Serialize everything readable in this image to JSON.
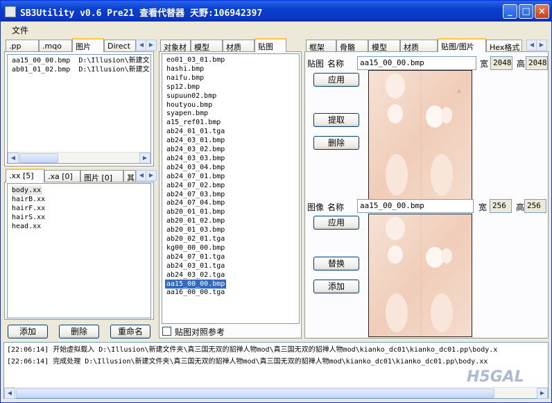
{
  "window": {
    "title": "SB3Utility v0.6 Pre21 查看代替器 天野:106942397",
    "minimize": "_",
    "maximize": "□",
    "close": "×"
  },
  "menu": {
    "file": "文件"
  },
  "left_top": {
    "tabs": [
      ".pp",
      ".mqo",
      "图片",
      "Direct"
    ],
    "items": [
      {
        "name": "aa15_00_00.bmp",
        "path": "D:\\Illusion\\新建文"
      },
      {
        "name": "ab01_01_02.bmp",
        "path": "D:\\Illusion\\新建文"
      }
    ]
  },
  "left_bottom": {
    "tabs": [
      ".xx [5]",
      ".xa [0]",
      "图片 [0]",
      "其"
    ],
    "items": [
      "body.xx",
      "hairB.xx",
      "hairF.xx",
      "hairS.xx",
      "head.xx"
    ],
    "buttons": {
      "add": "添加",
      "delete": "删除",
      "rename": "重命名"
    }
  },
  "middle": {
    "tabs": [
      "对象材",
      "模型",
      "材质",
      "贴图"
    ],
    "items": [
      "eo01_03_01.bmp",
      "hashi.bmp",
      "naifu.bmp",
      "sp12.bmp",
      "supuun02.bmp",
      "houtyou.bmp",
      "syapen.bmp",
      "a15_ref01.bmp",
      "ab24_01_01.tga",
      "ab24_03_01.bmp",
      "ab24_03_02.bmp",
      "ab24_03_03.bmp",
      "ab24_03_04.bmp",
      "ab24_07_01.bmp",
      "ab24_07_02.bmp",
      "ab24_07_03.bmp",
      "ab24_07_04.bmp",
      "ab20_01_01.bmp",
      "ab20_01_02.bmp",
      "ab20_01_03.bmp",
      "ab20_02_01.tga",
      "kg00_00_00.bmp",
      "ab24_07_01.tga",
      "ab24_03_01.tga",
      "ab24_03_02.tga",
      "aa15_00_00.bmp",
      "aa16_00_00.tga"
    ],
    "selected_index": 25,
    "checkbox_label": "贴图对照参考"
  },
  "right": {
    "tabs": [
      "框架",
      "骨骼",
      "模型",
      "材质",
      "贴图/图片",
      "Hex格式"
    ],
    "texture": {
      "label_left": "贴图",
      "label_name": "名称",
      "name": "aa15_00_00.bmp",
      "width_label": "宽",
      "width": "2048",
      "height_label": "高",
      "height": "2048",
      "apply": "应用",
      "extract": "提取",
      "delete": "删除"
    },
    "image": {
      "label_left": "图像",
      "label_name": "名称",
      "name": "aa15_00_00.bmp",
      "width_label": "宽",
      "width": "256",
      "height_label": "高",
      "height": "256",
      "apply": "应用",
      "replace": "替换",
      "add": "添加"
    }
  },
  "log": [
    "[22:06:14] 开始虚拟载入 D:\\Illusion\\新建文件夹\\真三国无双的貂禅人物mod\\真三国无双的貂禅人物mod\\kianko_dc01\\kianko_dc01.pp\\body.x",
    "[22:06:14] 完成处理 D:\\Illusion\\新建文件夹\\真三国无双的貂禅人物mod\\真三国无双的貂禅人物mod\\kianko_dc01\\kianko_dc01.pp\\body.xx"
  ],
  "watermark": "H5GAL"
}
